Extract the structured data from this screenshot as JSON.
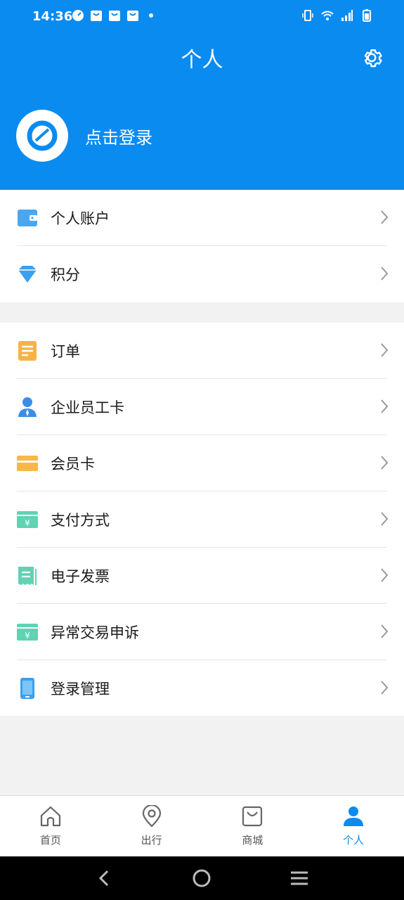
{
  "status_bar": {
    "time": "14:36",
    "left_icons": [
      "speed-dial-icon",
      "shopping-bag-icon",
      "shopping-bag-icon",
      "shopping-bag-icon",
      "dot-icon"
    ],
    "right_icons": [
      "vibrate-icon",
      "wifi-icon",
      "signal-icon",
      "battery-icon"
    ]
  },
  "header": {
    "title": "个人",
    "settings_icon": "gear-icon",
    "login_prompt": "点击登录",
    "avatar_icon": "app-logo-icon",
    "color": "#0a8bf0"
  },
  "menu_group_1": [
    {
      "icon": "wallet-icon",
      "label": "个人账户",
      "color": "#4aa7ef"
    },
    {
      "icon": "diamond-icon",
      "label": "积分",
      "color": "#3aa0ef"
    }
  ],
  "menu_group_2": [
    {
      "icon": "order-list-icon",
      "label": "订单",
      "color": "#f7b247"
    },
    {
      "icon": "employee-icon",
      "label": "企业员工卡",
      "color": "#3a8ee8"
    },
    {
      "icon": "member-card-icon",
      "label": "会员卡",
      "color": "#f8b847"
    },
    {
      "icon": "payment-icon",
      "label": "支付方式",
      "color": "#5fd3b4"
    },
    {
      "icon": "invoice-icon",
      "label": "电子发票",
      "color": "#5fd3b4"
    },
    {
      "icon": "payment-icon",
      "label": "异常交易申诉",
      "color": "#5fd3b4"
    },
    {
      "icon": "phone-icon",
      "label": "登录管理",
      "color": "#3aa0ef"
    }
  ],
  "tabbar": [
    {
      "icon": "home-icon",
      "label": "首页",
      "active": false
    },
    {
      "icon": "location-pin-icon",
      "label": "出行",
      "active": false
    },
    {
      "icon": "shopping-bag-icon",
      "label": "商城",
      "active": false
    },
    {
      "icon": "person-icon",
      "label": "个人",
      "active": true
    }
  ],
  "navbar": [
    "back-icon",
    "home-circle-icon",
    "menu-icon"
  ],
  "colors": {
    "accent": "#0a8bf0",
    "background": "#f2f2f2",
    "divider": "#e6e6e6"
  }
}
